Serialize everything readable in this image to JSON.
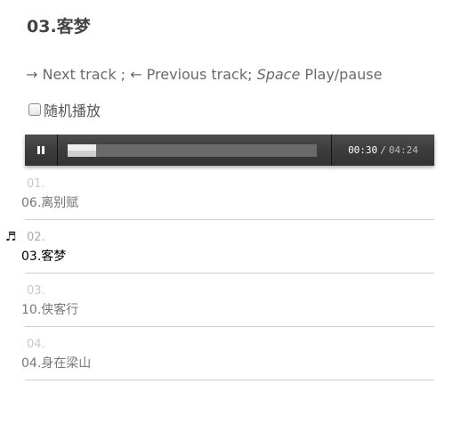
{
  "now_playing": {
    "title": "03.客梦"
  },
  "hint": {
    "next_key": "→",
    "next_text": "Next track ;",
    "prev_key": "←",
    "prev_text": "Previous track;",
    "space_key": "Space",
    "space_text": "Play/pause"
  },
  "shuffle": {
    "label": "随机播放",
    "checked": false
  },
  "player": {
    "state": "playing",
    "played": "00:30",
    "separator": "/",
    "duration": "04:24",
    "progress_fraction": 0.114,
    "loaded_fraction": 1.0,
    "colors": {
      "bar": "#3c3c3c",
      "progress": "#eeeeee",
      "track": "#5a5a5a"
    }
  },
  "playlist": {
    "current_index": 1,
    "now_playing_icon": "music-note-icon",
    "items": [
      {
        "num": "01.",
        "name": "06.离别赋"
      },
      {
        "num": "02.",
        "name": "03.客梦"
      },
      {
        "num": "03.",
        "name": "10.侠客行"
      },
      {
        "num": "04.",
        "name": "04.身在梁山"
      }
    ]
  }
}
